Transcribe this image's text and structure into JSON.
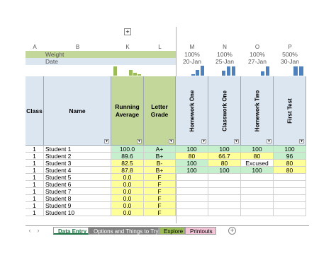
{
  "toolbar": {
    "expand_symbol": "+"
  },
  "columns": [
    "A",
    "B",
    "K",
    "L",
    "M",
    "N",
    "O",
    "P"
  ],
  "meta_rows": {
    "weight_label": "Weight",
    "date_label": "Date",
    "weights": [
      "100%",
      "100%",
      "100%",
      "500%"
    ],
    "dates": [
      "20-Jan",
      "25-Jan",
      "27-Jan",
      "30-Jan"
    ]
  },
  "headers": {
    "class": "Class",
    "name": "Name",
    "running_average": [
      "Running",
      "Average"
    ],
    "letter_grade": [
      "Letter",
      "Grade"
    ],
    "assignments": [
      "Homework One",
      "Classwork  One",
      "Homework Two",
      "First Test"
    ]
  },
  "filter_icon": "▾",
  "rows": [
    {
      "class": "1",
      "name": "Student 1",
      "avg": "100.0",
      "grade": "A+",
      "scores": [
        "100",
        "100",
        "100",
        "100"
      ]
    },
    {
      "class": "1",
      "name": "Student 2",
      "avg": "89.6",
      "grade": "B+",
      "scores": [
        "80",
        "66.7",
        "80",
        "96"
      ]
    },
    {
      "class": "1",
      "name": "Student 3",
      "avg": "82.5",
      "grade": "B-",
      "scores": [
        "100",
        "80",
        "Excused",
        "80"
      ]
    },
    {
      "class": "1",
      "name": "Student 4",
      "avg": "87.8",
      "grade": "B+",
      "scores": [
        "100",
        "100",
        "100",
        "80"
      ]
    },
    {
      "class": "1",
      "name": "Student 5",
      "avg": "0.0",
      "grade": "F",
      "scores": [
        "",
        "",
        "",
        ""
      ]
    },
    {
      "class": "1",
      "name": "Student 6",
      "avg": "0.0",
      "grade": "F",
      "scores": [
        "",
        "",
        "",
        ""
      ]
    },
    {
      "class": "1",
      "name": "Student 7",
      "avg": "0.0",
      "grade": "F",
      "scores": [
        "",
        "",
        "",
        ""
      ]
    },
    {
      "class": "1",
      "name": "Student 8",
      "avg": "0.0",
      "grade": "F",
      "scores": [
        "",
        "",
        "",
        ""
      ]
    },
    {
      "class": "1",
      "name": "Student 9",
      "avg": "0.0",
      "grade": "F",
      "scores": [
        "",
        "",
        "",
        ""
      ]
    },
    {
      "class": "1",
      "name": "Student 10",
      "avg": "0.0",
      "grade": "F",
      "scores": [
        "",
        "",
        "",
        ""
      ]
    }
  ],
  "sheet_tabs": [
    "Data Entry",
    "Options and Things to Try",
    "Explore",
    "Printouts"
  ],
  "add_sheet": "+",
  "nav_arrows": [
    "‹",
    "›"
  ],
  "colors": {
    "header_blue": "#dce6f1",
    "green": "#c6efce",
    "yellow": "#ffff99",
    "olive": "#c4d79b",
    "olive_dark": "#9bbb59",
    "bar_blue": "#4f81bd"
  }
}
